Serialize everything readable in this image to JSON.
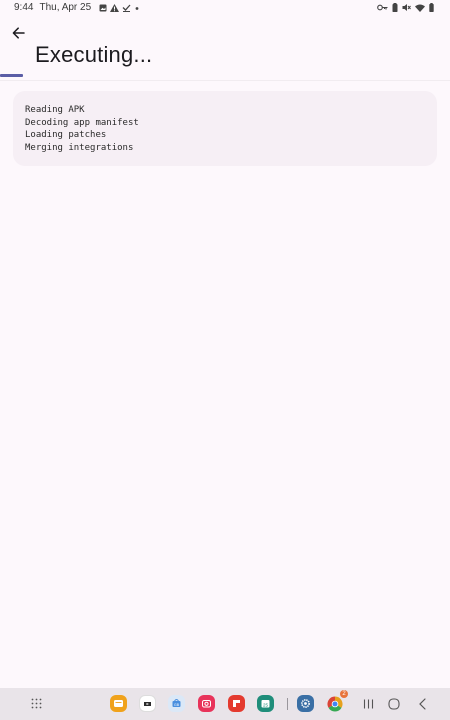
{
  "status_bar": {
    "time": "9:44",
    "date": "Thu, Apr 25",
    "left_icons": [
      "image-icon",
      "warning-icon",
      "download-done-icon",
      "dot-icon"
    ],
    "right_icons": [
      "key-icon",
      "battery-saver-icon",
      "mute-icon",
      "wifi-icon",
      "battery-icon"
    ]
  },
  "header": {
    "back_icon": "arrow-back-icon",
    "title": "Executing..."
  },
  "progress": {
    "value": 0.05,
    "color": "#5b5ea6"
  },
  "log": {
    "lines": [
      "Reading APK",
      "Decoding app manifest",
      "Loading patches",
      "Merging integrations"
    ]
  },
  "dock": {
    "apps": [
      {
        "name": "app-drawer-icon"
      },
      {
        "name": "notes-app-icon",
        "color": "#f0a21b"
      },
      {
        "name": "video-app-icon",
        "color": "#2b2b2b"
      },
      {
        "name": "store-app-icon",
        "color": "#4a8fdf"
      },
      {
        "name": "camera-app-icon",
        "color": "#e8335a"
      },
      {
        "name": "flipboard-app-icon",
        "color": "#e43a2f"
      },
      {
        "name": "calendar-app-icon",
        "color": "#1f8d7a"
      },
      {
        "name": "settings-app-icon",
        "color": "#3a6fa5"
      },
      {
        "name": "chrome-app-icon",
        "color": "#e6a11d"
      }
    ],
    "chrome_badge": "2"
  },
  "nav": {
    "buttons": [
      "recents-button",
      "home-button",
      "back-button"
    ]
  },
  "colors": {
    "background": "#fdf8fc",
    "card": "#f6eff5",
    "accent": "#5b5ea6"
  }
}
